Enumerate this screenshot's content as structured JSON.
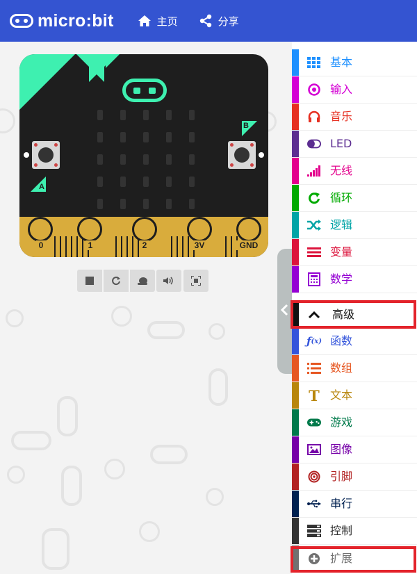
{
  "header": {
    "logo_text": "micro:bit",
    "home_label": "主页",
    "share_label": "分享",
    "bg_color": "#3454d1"
  },
  "simulator": {
    "pins": [
      "0",
      "1",
      "2",
      "3V",
      "GND"
    ],
    "button_a_label": "A",
    "button_b_label": "B",
    "board_color": "#1e1e1e",
    "accent_color": "#3ef0b0",
    "edge_color": "#d9ac3c",
    "controls": [
      {
        "name": "stop",
        "icon": "stop-icon"
      },
      {
        "name": "restart",
        "icon": "restart-icon"
      },
      {
        "name": "slow-mo",
        "icon": "snail-icon"
      },
      {
        "name": "mute",
        "icon": "sound-icon"
      },
      {
        "name": "fullscreen",
        "icon": "fullscreen-icon"
      }
    ]
  },
  "toolbox": {
    "categories": [
      {
        "label": "基本",
        "color": "#1e90ff",
        "icon": "grid-icon"
      },
      {
        "label": "输入",
        "color": "#d400d4",
        "icon": "target-icon"
      },
      {
        "label": "音乐",
        "color": "#e63022",
        "icon": "headphones-icon"
      },
      {
        "label": "LED",
        "color": "#5c2d91",
        "icon": "toggle-icon"
      },
      {
        "label": "无线",
        "color": "#e3008c",
        "icon": "signal-icon"
      },
      {
        "label": "循环",
        "color": "#00aa00",
        "icon": "refresh-icon"
      },
      {
        "label": "逻辑",
        "color": "#00a4a6",
        "icon": "shuffle-icon"
      },
      {
        "label": "变量",
        "color": "#dc143c",
        "icon": "lines-icon"
      },
      {
        "label": "数学",
        "color": "#9400d3",
        "icon": "calculator-icon"
      },
      {
        "label": "高级",
        "color": "#111111",
        "icon": "chevron-up-icon"
      },
      {
        "label": "函数",
        "color": "#3455db",
        "icon": "function-icon"
      },
      {
        "label": "数组",
        "color": "#e65722",
        "icon": "list-icon"
      },
      {
        "label": "文本",
        "color": "#b8860b",
        "icon": "text-icon"
      },
      {
        "label": "游戏",
        "color": "#007a4b",
        "icon": "gamepad-icon"
      },
      {
        "label": "图像",
        "color": "#7600a8",
        "icon": "image-icon"
      },
      {
        "label": "引脚",
        "color": "#b22222",
        "icon": "pin-icon"
      },
      {
        "label": "串行",
        "color": "#002050",
        "icon": "usb-icon"
      },
      {
        "label": "控制",
        "color": "#333333",
        "icon": "server-icon"
      },
      {
        "label": "扩展",
        "color": "#717171",
        "icon": "plus-circle-icon"
      }
    ]
  }
}
